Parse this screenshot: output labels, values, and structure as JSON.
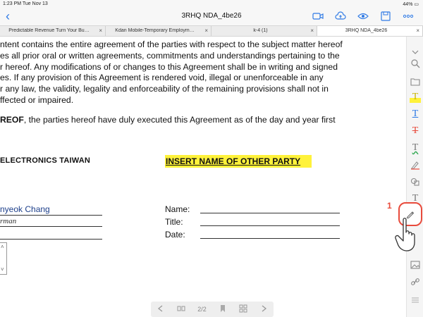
{
  "status": {
    "time_date": "1:23 PM  Tue Nov 13",
    "battery": "44%"
  },
  "nav": {
    "back": "‹",
    "title": "3RHQ NDA_4be26"
  },
  "tabs": [
    {
      "label": "Predictable Revenue Turn Your Bu…",
      "close": "×"
    },
    {
      "label": "Kdan Mobile-Temporary Employm…",
      "close": "×"
    },
    {
      "label": "k-4 (1)",
      "close": "×"
    },
    {
      "label": "3RHQ NDA_4be26",
      "close": "×"
    }
  ],
  "doc": {
    "lines": [
      "ntent contains the entire agreement of the parties with respect to the subject matter hereof",
      "es all prior oral or written agreements, commitments and understandings pertaining to the",
      "r hereof. Any modifications of or changes to this Agreement shall be in writing and signed",
      "es. If any provision of this Agreement is rendered void, illegal or unenforceable in any",
      "r any law, the validity, legality and enforceability of the remaining provisions shall not in",
      "ffected or impaired."
    ],
    "witness_bold": "REOF",
    "witness_rest": ", the parties hereof have duly executed this Agreement as of the day and year first",
    "party_left": "ELECTRONICS   TAIWAN",
    "party_right": "INSERT NAME OF OTHER PARTY",
    "signer_name": "nyeok Chang",
    "signer_title": "rman",
    "fields": {
      "name": "Name:",
      "title": "Title:",
      "date": "Date:"
    }
  },
  "bottombar": {
    "page": "2/2"
  },
  "callout": {
    "step": "1"
  },
  "colors": {
    "accent": "#2f7ae5",
    "highlight": "#fff23a",
    "callout": "#e84b3c"
  }
}
